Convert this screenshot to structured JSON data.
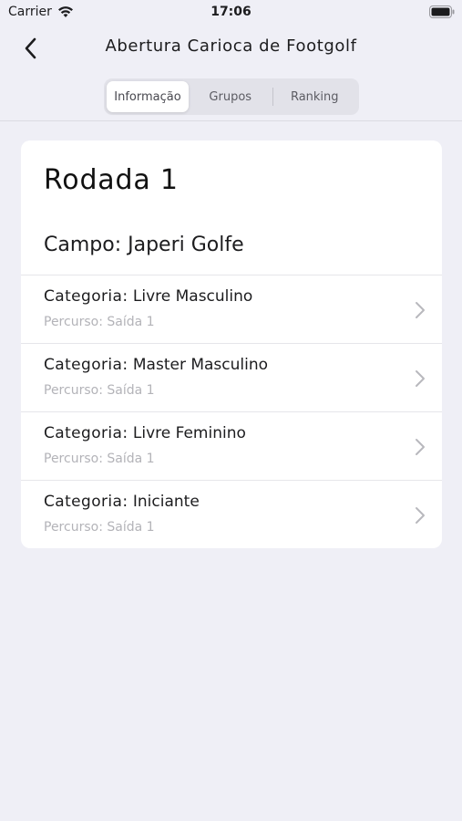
{
  "status_bar": {
    "carrier": "Carrier",
    "time": "17:06"
  },
  "nav": {
    "title": "Abertura Carioca de Footgolf"
  },
  "tabs": [
    {
      "label": "Informação",
      "active": true
    },
    {
      "label": "Grupos",
      "active": false
    },
    {
      "label": "Ranking",
      "active": false
    }
  ],
  "card": {
    "round_title": "Rodada 1",
    "campo_key": "Campo:",
    "campo_value": "Japeri Golfe",
    "items": [
      {
        "cat_key": "Categoria:",
        "cat_value": "Livre Masculino",
        "route_key": "Percurso:",
        "route_value": "Saída 1"
      },
      {
        "cat_key": "Categoria:",
        "cat_value": "Master Masculino",
        "route_key": "Percurso:",
        "route_value": "Saída 1"
      },
      {
        "cat_key": "Categoria:",
        "cat_value": "Livre Feminino",
        "route_key": "Percurso:",
        "route_value": "Saída 1"
      },
      {
        "cat_key": "Categoria:",
        "cat_value": "Iniciante",
        "route_key": "Percurso:",
        "route_value": "Saída 1"
      }
    ]
  },
  "icons": {
    "back": "chevron-left-icon",
    "row_disclosure": "chevron-right-icon",
    "wifi": "wifi-icon",
    "battery": "battery-icon"
  },
  "colors": {
    "background": "#efeff6",
    "card": "#ffffff",
    "secondary_text": "#b3b3b8"
  }
}
